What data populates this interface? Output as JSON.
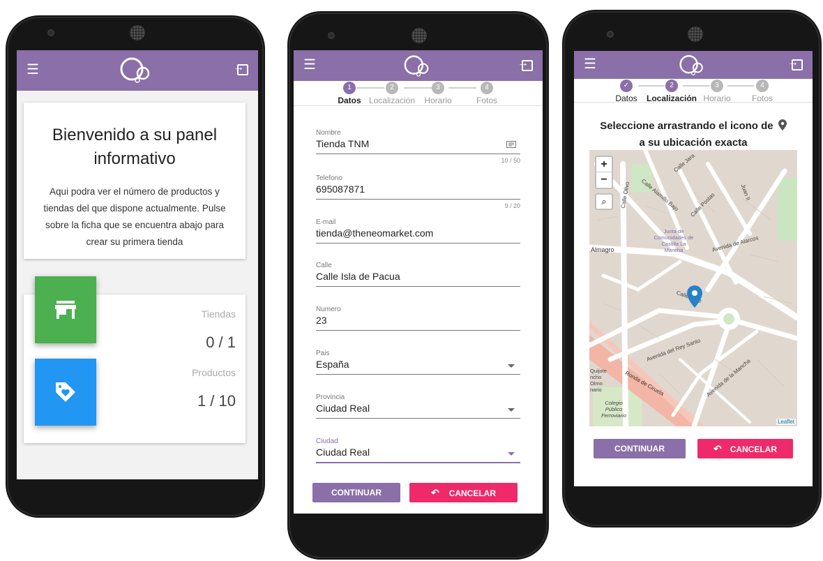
{
  "colors": {
    "primary": "#8a6fa8",
    "accent": "#ee2a6b",
    "green": "#4caf50",
    "blue": "#2196f3"
  },
  "icons": {
    "menu": "menu-icon",
    "exit": "exit-icon",
    "store": "store-icon",
    "tag": "tag-heart-icon",
    "contact": "contact-card-icon",
    "pin": "map-pin-icon",
    "undo": "undo-icon",
    "zoom_in": "zoom-in-icon",
    "zoom_out": "zoom-out-icon",
    "search": "search-icon"
  },
  "phone1": {
    "welcome_title": "Bienvenido a su panel informativo",
    "welcome_text": "Aqui podra ver el número de productos y tiendas del que dispone actualmente. Pulse sobre la ficha que se encuentra abajo para crear su primera tienda",
    "stores_label": "Tiendas",
    "stores_value": "0 / 1",
    "products_label": "Productos",
    "products_value": "1 / 10"
  },
  "phone2": {
    "steps": [
      {
        "num": "1",
        "label": "Datos"
      },
      {
        "num": "2",
        "label": "Localización"
      },
      {
        "num": "3",
        "label": "Horario"
      },
      {
        "num": "4",
        "label": "Fotos"
      }
    ],
    "fields": {
      "nombre": {
        "label": "Nombre",
        "value": "Tienda TNM",
        "counter": "10 / 50"
      },
      "telefono": {
        "label": "Telefono",
        "value": "695087871",
        "counter": "9 / 20"
      },
      "email": {
        "label": "E-mail",
        "value": "tienda@theneomarket.com"
      },
      "calle": {
        "label": "Calle",
        "value": "Calle Isla de Pacua"
      },
      "numero": {
        "label": "Numero",
        "value": "23"
      },
      "pais": {
        "label": "Pais",
        "value": "España"
      },
      "provincia": {
        "label": "Provincia",
        "value": "Ciudad Real"
      },
      "ciudad": {
        "label": "Ciudad",
        "value": "Ciudad Real"
      }
    },
    "continue_label": "CONTINUAR",
    "cancel_label": "CANCELAR"
  },
  "phone3": {
    "steps": [
      {
        "num": "✓",
        "label": "Datos"
      },
      {
        "num": "2",
        "label": "Localización"
      },
      {
        "num": "3",
        "label": "Horario"
      },
      {
        "num": "4",
        "label": "Fotos"
      }
    ],
    "instruction_line1": "Seleccione arrastrando el icono de",
    "instruction_line2": "a su ubicación exacta",
    "map_attribution": "Leaflet",
    "map_zoom_in": "+",
    "map_zoom_out": "−",
    "map_labels": {
      "almagro": "Almagro",
      "calle_jara": "Calle Jara",
      "calle_olivo": "Calle Olivo",
      "calle_alamillo": "Calle Alamillo Bajo",
      "calle_postas": "Calle Postas",
      "juan_ii": "Juan II",
      "junta": "Junta de Comunidades de Castilla La Mancha",
      "avenida_alarcos": "Avenida de Alarcos",
      "calle_tinte": "Calle Tinte",
      "avenida_rey_santo": "Avenida del Rey Santo",
      "ronda_ciruela": "Ronda de Ciruela",
      "avenida_mancha": "Avenida de la Mancha",
      "colegio": "Colegio Público Ferroviario",
      "quijote": "Quijote ncho Olmo nario"
    },
    "continue_label": "CONTINUAR",
    "cancel_label": "CANCELAR"
  }
}
